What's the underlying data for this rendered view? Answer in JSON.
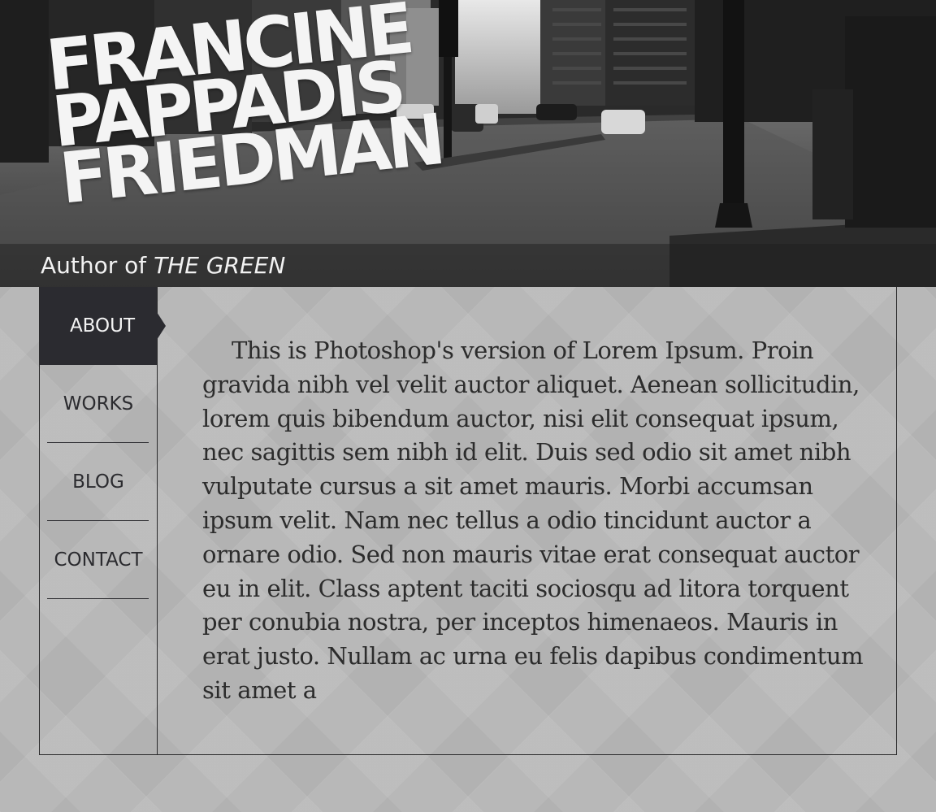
{
  "header": {
    "title_lines": [
      "FRANCINE",
      "PAPPADIS",
      "FRIEDMAN"
    ],
    "subtitle_prefix": "Author of ",
    "subtitle_book": "THE GREEN"
  },
  "nav": {
    "items": [
      {
        "label": "ABOUT",
        "active": true
      },
      {
        "label": "WORKS",
        "active": false
      },
      {
        "label": "BLOG",
        "active": false
      },
      {
        "label": "CONTACT",
        "active": false
      }
    ]
  },
  "main": {
    "body_text": "This is Photoshop's version  of Lorem Ipsum. Proin gravida nibh vel velit auctor aliquet. Aenean sollicitudin, lorem quis bibendum auctor, nisi elit consequat ipsum, nec sagittis sem nibh id elit. Duis sed odio sit amet nibh vulputate cursus a sit amet mauris. Morbi accumsan ipsum velit. Nam nec tellus a odio tincidunt auctor a ornare odio. Sed non  mauris vitae erat consequat auctor eu in elit. Class aptent taciti sociosqu ad litora torquent per conubia nostra, per inceptos himenaeos. Mauris in erat justo. Nullam ac urna eu felis dapibus condimentum sit amet a"
  },
  "colors": {
    "nav_active_bg": "#2b2b30",
    "panel_border": "#2a2a2b",
    "page_bg": "#bababa",
    "text": "#2c2c2c"
  }
}
